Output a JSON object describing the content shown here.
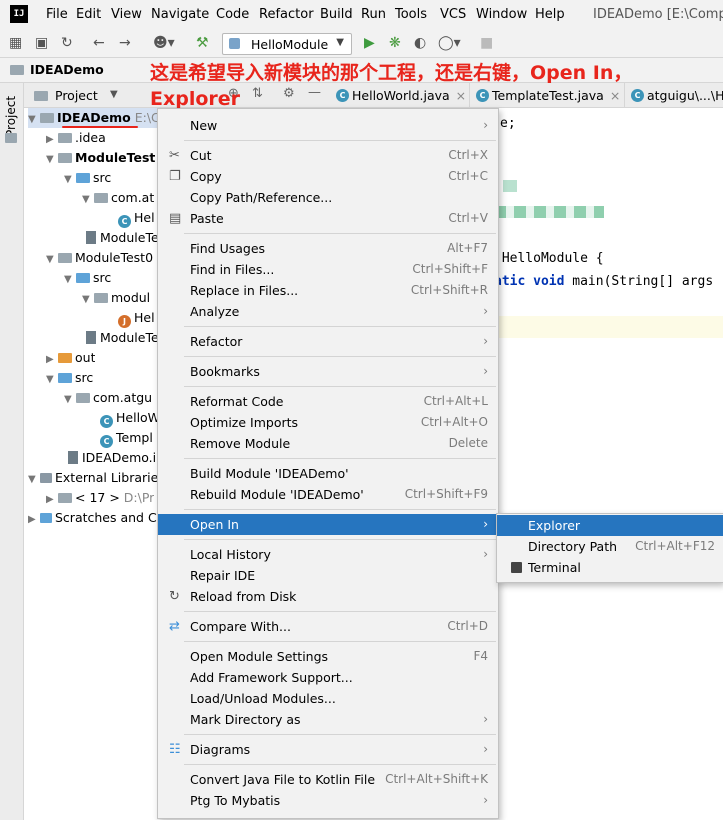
{
  "app": {
    "logo": "IJ",
    "window_title": "IDEADemo [E:\\Compu"
  },
  "menubar": [
    "File",
    "Edit",
    "View",
    "Navigate",
    "Code",
    "Refactor",
    "Build",
    "Run",
    "Tools",
    "VCS",
    "Window",
    "Help"
  ],
  "toolbar": {
    "run_config": "HelloModule",
    "icons": [
      "open-folder-icon",
      "save-icon",
      "sync-icon",
      "back-icon",
      "forward-icon",
      "user-icon",
      "build-hammer-icon",
      "run-icon",
      "debug-icon",
      "coverage-icon",
      "profile-icon",
      "stop-icon"
    ]
  },
  "navbar": {
    "project": "IDEADemo"
  },
  "sidebar": {
    "project_tab": "Project"
  },
  "project_panel": {
    "header": "Project"
  },
  "annotation": {
    "line1": "这是希望导入新模块的那个工程，还是右键，Open In，",
    "line2": "Explorer"
  },
  "tabs": [
    {
      "label": "HelloWorld.java"
    },
    {
      "label": "TemplateTest.java"
    },
    {
      "label": "atguigu\\...\\H"
    }
  ],
  "tree": [
    {
      "label": "IDEADemo",
      "suffix": "E:\\C"
    },
    {
      "label": ".idea"
    },
    {
      "label": "ModuleTest"
    },
    {
      "label": "src"
    },
    {
      "label": "com.at"
    },
    {
      "label": "Hel"
    },
    {
      "label": "ModuleTe"
    },
    {
      "label": "ModuleTest0"
    },
    {
      "label": "src"
    },
    {
      "label": "modul"
    },
    {
      "label": "Hel"
    },
    {
      "label": "ModuleTe"
    },
    {
      "label": "out"
    },
    {
      "label": "src"
    },
    {
      "label": "com.atgu"
    },
    {
      "label": "HelloW"
    },
    {
      "label": "Templ"
    },
    {
      "label": "IDEADemo.in"
    },
    {
      "label": "External Librarie"
    },
    {
      "label": "< 17 >",
      "suffix": "D:\\Pr"
    },
    {
      "label": "Scratches and C"
    }
  ],
  "editor": {
    "line1": "e;",
    "line2_plain": " HelloModule {",
    "line3_kw": "atic void",
    "line3_rest": " main(String[] args"
  },
  "context_menu": [
    {
      "label": "New",
      "submenu": true
    },
    {
      "label": "Cut",
      "shortcut": "Ctrl+X",
      "icon": "cut-icon"
    },
    {
      "label": "Copy",
      "shortcut": "Ctrl+C",
      "icon": "copy-icon"
    },
    {
      "label": "Copy Path/Reference..."
    },
    {
      "label": "Paste",
      "shortcut": "Ctrl+V",
      "icon": "paste-icon"
    },
    {
      "label": "Find Usages",
      "shortcut": "Alt+F7"
    },
    {
      "label": "Find in Files...",
      "shortcut": "Ctrl+Shift+F"
    },
    {
      "label": "Replace in Files...",
      "shortcut": "Ctrl+Shift+R"
    },
    {
      "label": "Analyze",
      "submenu": true
    },
    {
      "label": "Refactor",
      "submenu": true
    },
    {
      "label": "Bookmarks",
      "submenu": true
    },
    {
      "label": "Reformat Code",
      "shortcut": "Ctrl+Alt+L"
    },
    {
      "label": "Optimize Imports",
      "shortcut": "Ctrl+Alt+O"
    },
    {
      "label": "Remove Module",
      "shortcut": "Delete"
    },
    {
      "label": "Build Module 'IDEADemo'"
    },
    {
      "label": "Rebuild Module 'IDEADemo'",
      "shortcut": "Ctrl+Shift+F9"
    },
    {
      "label": "Open In",
      "submenu": true,
      "selected": true
    },
    {
      "label": "Local History",
      "submenu": true
    },
    {
      "label": "Repair IDE"
    },
    {
      "label": "Reload from Disk",
      "icon": "reload-icon"
    },
    {
      "label": "Compare With...",
      "shortcut": "Ctrl+D",
      "icon": "compare-icon"
    },
    {
      "label": "Open Module Settings",
      "shortcut": "F4"
    },
    {
      "label": "Add Framework Support..."
    },
    {
      "label": "Load/Unload Modules..."
    },
    {
      "label": "Mark Directory as",
      "submenu": true
    },
    {
      "label": "Diagrams",
      "submenu": true,
      "icon": "diagram-icon"
    },
    {
      "label": "Convert Java File to Kotlin File",
      "shortcut": "Ctrl+Alt+Shift+K"
    },
    {
      "label": "Ptg To Mybatis",
      "submenu": true
    }
  ],
  "open_in_submenu": [
    {
      "label": "Explorer",
      "selected": true
    },
    {
      "label": "Directory Path",
      "shortcut": "Ctrl+Alt+F12"
    },
    {
      "label": "Terminal",
      "icon": "terminal-icon"
    }
  ]
}
